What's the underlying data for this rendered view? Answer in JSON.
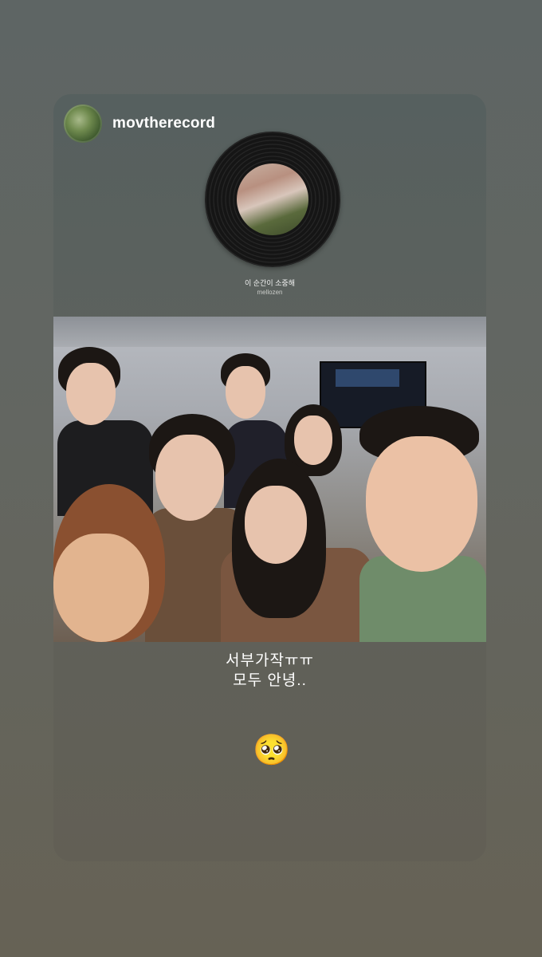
{
  "story": {
    "username": "movtherecord",
    "music": {
      "title": "이 순간이 소중해",
      "artist": "mellozen"
    },
    "caption": {
      "line1": "서부가작ㅠㅠ",
      "line2": "모두 안녕.."
    },
    "emoji": "🥺"
  },
  "colors": {
    "background": "#616560",
    "card": "#5c605b",
    "text": "#ffffff"
  },
  "icons": {
    "avatar": "profile-avatar",
    "music": "vinyl-record-icon"
  }
}
